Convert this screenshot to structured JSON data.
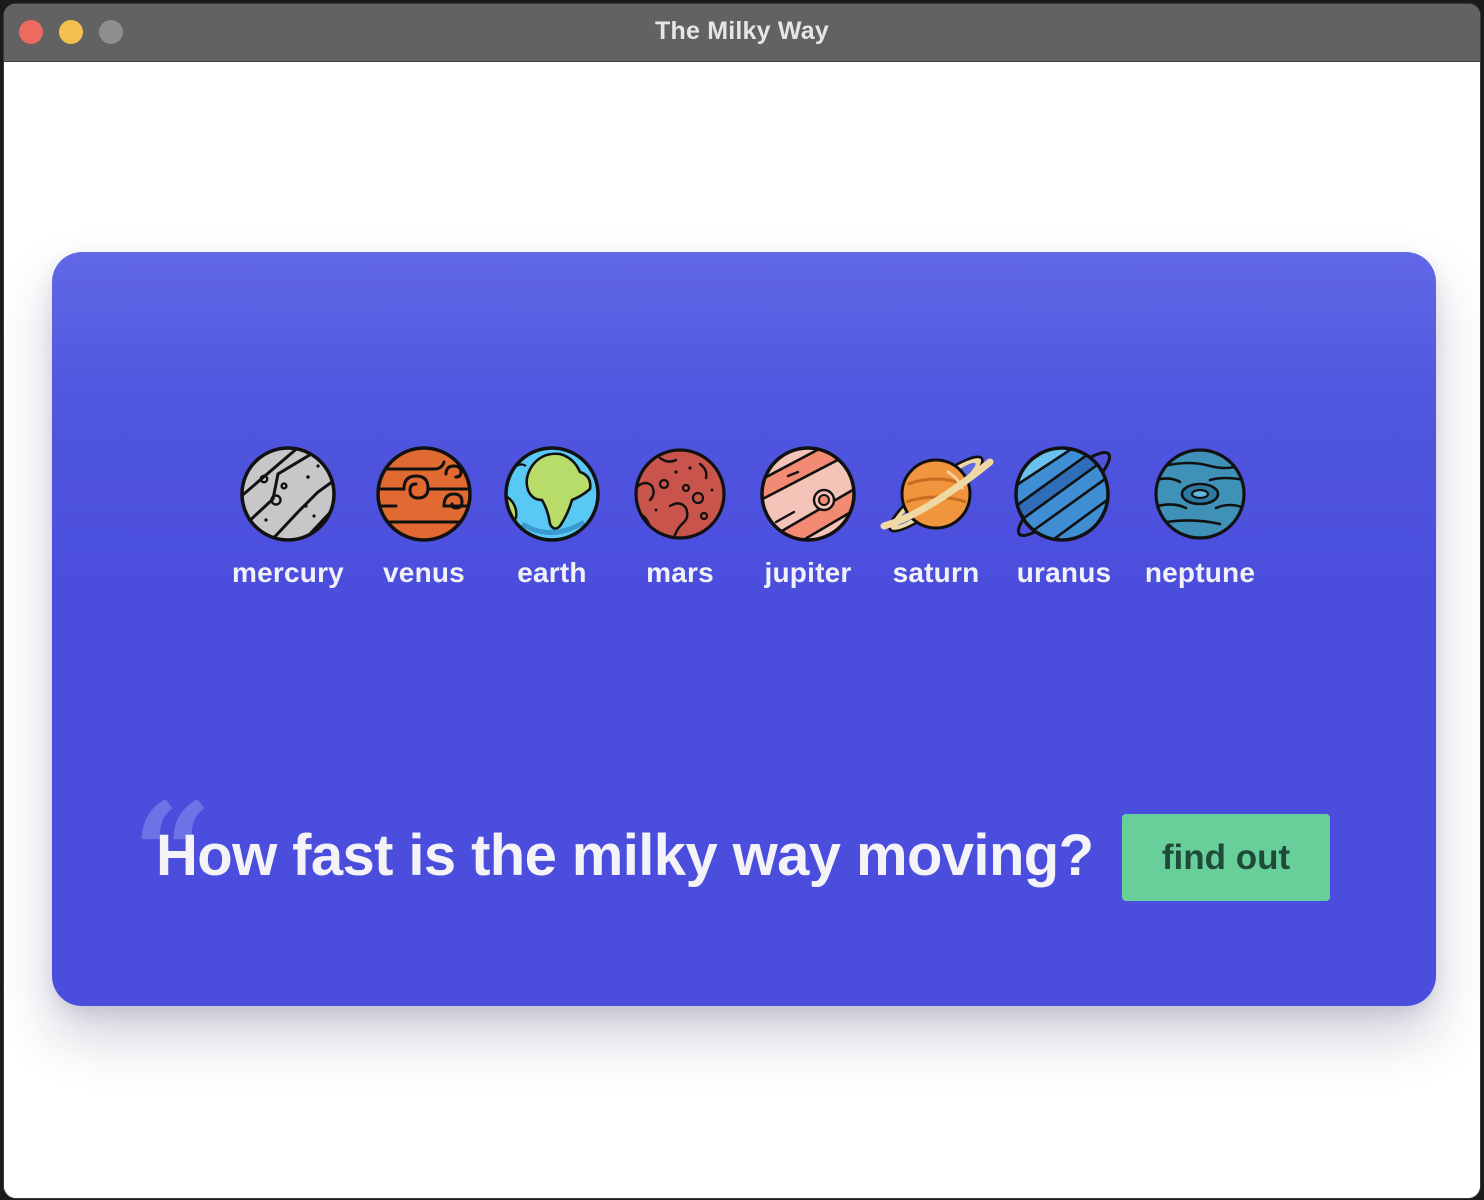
{
  "window": {
    "title": "The Milky Way"
  },
  "planets": [
    {
      "name": "mercury",
      "icon": "mercury-icon",
      "color": "#c7c7c9"
    },
    {
      "name": "venus",
      "icon": "venus-icon",
      "color": "#e06a32"
    },
    {
      "name": "earth",
      "icon": "earth-icon",
      "color": "#59c8f4"
    },
    {
      "name": "mars",
      "icon": "mars-icon",
      "color": "#c9544c"
    },
    {
      "name": "jupiter",
      "icon": "jupiter-icon",
      "color": "#f28a74"
    },
    {
      "name": "saturn",
      "icon": "saturn-icon",
      "color": "#f0943d"
    },
    {
      "name": "uranus",
      "icon": "uranus-icon",
      "color": "#3f8ed3"
    },
    {
      "name": "neptune",
      "icon": "neptune-icon",
      "color": "#3f91b8"
    }
  ],
  "hero": {
    "question": "How fast is the milky way moving?",
    "button_label": "find out",
    "quote_icon": "quote-mark-icon"
  },
  "colors": {
    "card_top": "#6168e6",
    "card": "#4b4edd",
    "button": "#68cf9b",
    "button_text": "#1f4a39",
    "titlebar": "#626262"
  }
}
